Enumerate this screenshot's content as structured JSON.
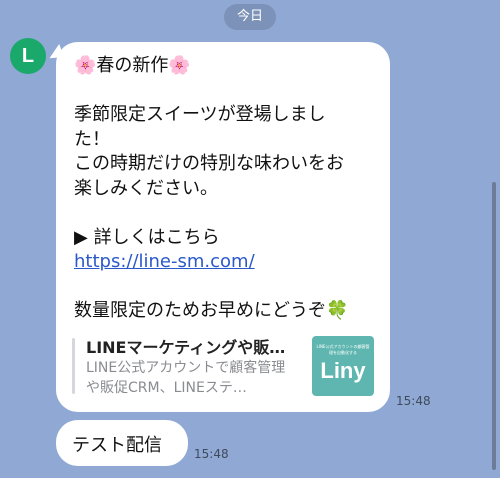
{
  "date_separator": "今日",
  "avatar": {
    "letter": "L",
    "color": "#1aa86b"
  },
  "message1": {
    "line_title": "🌸春の新作🌸",
    "line_blank1": "",
    "line_body1": "季節限定スイーツが登場しまし",
    "line_body2": "た！",
    "line_body3": "この時期だけの特別な味わいをお",
    "line_body4": "楽しみください。",
    "line_blank2": "",
    "line_details": "▶ 詳しくはこちら",
    "link": "https://line-sm.com/",
    "line_blank3": "",
    "line_limited": "数量限定のためお早めにどうぞ🍀",
    "time": "15:48"
  },
  "link_preview": {
    "title": "LINEマーケティングや販…",
    "description": "LINE公式アカウントで顧客管理や販促CRM、LINEステ…",
    "thumbnail_top": "LINE公式アカウントの顧客管理を自動化する",
    "thumbnail_logo": "Liny"
  },
  "message2": {
    "text": "テスト配信",
    "time": "15:48"
  },
  "colors": {
    "background": "#8fa9d4",
    "bubble": "#ffffff",
    "link": "#2a59c9",
    "thumbnail": "#5fb6b0"
  }
}
